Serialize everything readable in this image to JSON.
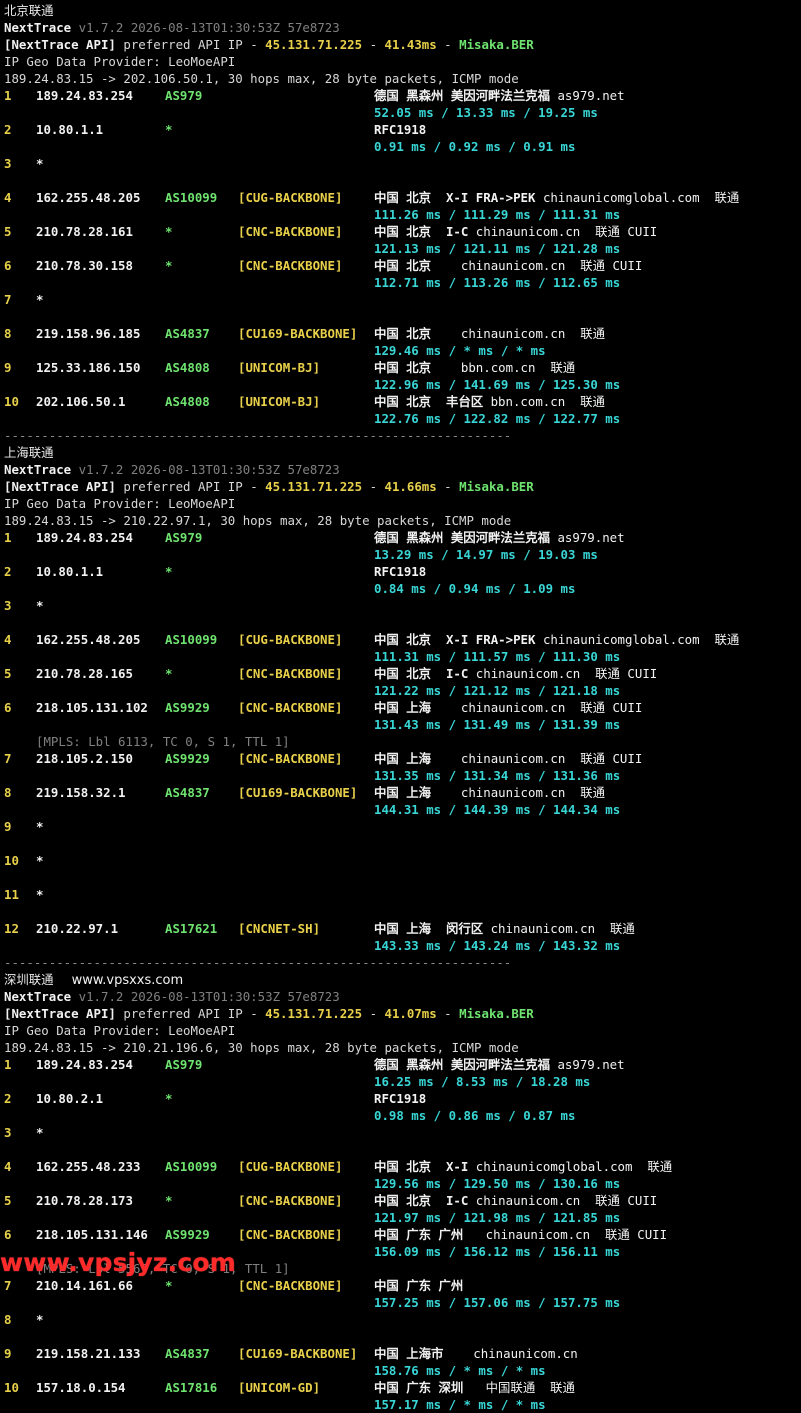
{
  "sections": [
    {
      "title": "北京联通",
      "extra": "",
      "version": "v1.7.2 2026-08-13T01:30:53Z 57e8723",
      "api_prefix": "preferred API IP - ",
      "api_ip": "45.131.71.225",
      "api_ms": "41.43ms",
      "api_node": "Misaka.BER",
      "geo_provider": "IP Geo Data Provider: LeoMoeAPI",
      "route": "189.24.83.15 -> 202.106.50.1, 30 hops max, 28 byte packets, ICMP mode",
      "hops": [
        {
          "n": "1",
          "ip": "189.24.83.254",
          "as": "AS979",
          "tag": "",
          "geo_b": "德国 黑森州 美因河畔法兰克福",
          "geo_n": "as979.net",
          "rtt": "52.05 ms / 13.33 ms / 19.25 ms",
          "mpls": ""
        },
        {
          "n": "2",
          "ip": "10.80.1.1",
          "as": "*",
          "tag": "",
          "geo_b": "RFC1918",
          "geo_n": "",
          "rtt": "0.91 ms / 0.92 ms / 0.91 ms",
          "mpls": ""
        },
        {
          "n": "3",
          "ip": "*",
          "as": "",
          "tag": "",
          "geo_b": "",
          "geo_n": "",
          "rtt": "",
          "mpls": ""
        },
        {
          "n": "4",
          "ip": "162.255.48.205",
          "as": "AS10099",
          "tag": "[CUG-BACKBONE]",
          "geo_b": "中国 北京  X-I FRA->PEK",
          "geo_n": "chinaunicomglobal.com  联通",
          "rtt": "111.26 ms / 111.29 ms / 111.31 ms",
          "mpls": ""
        },
        {
          "n": "5",
          "ip": "210.78.28.161",
          "as": "*",
          "tag": "[CNC-BACKBONE]",
          "geo_b": "中国 北京  I-C",
          "geo_n": "chinaunicom.cn  联通 CUII",
          "rtt": "121.13 ms / 121.11 ms / 121.28 ms",
          "mpls": ""
        },
        {
          "n": "6",
          "ip": "210.78.30.158",
          "as": "*",
          "tag": "[CNC-BACKBONE]",
          "geo_b": "中国 北京",
          "geo_n": "   chinaunicom.cn  联通 CUII",
          "rtt": "112.71 ms / 113.26 ms / 112.65 ms",
          "mpls": ""
        },
        {
          "n": "7",
          "ip": "*",
          "as": "",
          "tag": "",
          "geo_b": "",
          "geo_n": "",
          "rtt": "",
          "mpls": ""
        },
        {
          "n": "8",
          "ip": "219.158.96.185",
          "as": "AS4837",
          "tag": "[CU169-BACKBONE]",
          "geo_b": "中国 北京",
          "geo_n": "   chinaunicom.cn  联通",
          "rtt": "129.46 ms / * ms / * ms",
          "mpls": ""
        },
        {
          "n": "9",
          "ip": "125.33.186.150",
          "as": "AS4808",
          "tag": "[UNICOM-BJ]",
          "geo_b": "中国 北京",
          "geo_n": "   bbn.com.cn  联通",
          "rtt": "122.96 ms / 141.69 ms / 125.30 ms",
          "mpls": ""
        },
        {
          "n": "10",
          "ip": "202.106.50.1",
          "as": "AS4808",
          "tag": "[UNICOM-BJ]",
          "geo_b": "中国 北京  丰台区",
          "geo_n": "bbn.com.cn  联通",
          "rtt": "122.76 ms / 122.82 ms / 122.77 ms",
          "mpls": ""
        }
      ]
    },
    {
      "title": "上海联通",
      "extra": "",
      "version": "v1.7.2 2026-08-13T01:30:53Z 57e8723",
      "api_prefix": "preferred API IP - ",
      "api_ip": "45.131.71.225",
      "api_ms": "41.66ms",
      "api_node": "Misaka.BER",
      "geo_provider": "IP Geo Data Provider: LeoMoeAPI",
      "route": "189.24.83.15 -> 210.22.97.1, 30 hops max, 28 byte packets, ICMP mode",
      "hops": [
        {
          "n": "1",
          "ip": "189.24.83.254",
          "as": "AS979",
          "tag": "",
          "geo_b": "德国 黑森州 美因河畔法兰克福",
          "geo_n": "as979.net",
          "rtt": "13.29 ms / 14.97 ms / 19.03 ms",
          "mpls": ""
        },
        {
          "n": "2",
          "ip": "10.80.1.1",
          "as": "*",
          "tag": "",
          "geo_b": "RFC1918",
          "geo_n": "",
          "rtt": "0.84 ms / 0.94 ms / 1.09 ms",
          "mpls": ""
        },
        {
          "n": "3",
          "ip": "*",
          "as": "",
          "tag": "",
          "geo_b": "",
          "geo_n": "",
          "rtt": "",
          "mpls": ""
        },
        {
          "n": "4",
          "ip": "162.255.48.205",
          "as": "AS10099",
          "tag": "[CUG-BACKBONE]",
          "geo_b": "中国 北京  X-I FRA->PEK",
          "geo_n": "chinaunicomglobal.com  联通",
          "rtt": "111.31 ms / 111.57 ms / 111.30 ms",
          "mpls": ""
        },
        {
          "n": "5",
          "ip": "210.78.28.165",
          "as": "*",
          "tag": "[CNC-BACKBONE]",
          "geo_b": "中国 北京  I-C",
          "geo_n": "chinaunicom.cn  联通 CUII",
          "rtt": "121.22 ms / 121.12 ms / 121.18 ms",
          "mpls": ""
        },
        {
          "n": "6",
          "ip": "218.105.131.102",
          "as": "AS9929",
          "tag": "[CNC-BACKBONE]",
          "geo_b": "中国 上海",
          "geo_n": "   chinaunicom.cn  联通 CUII",
          "rtt": "131.43 ms / 131.49 ms / 131.39 ms",
          "mpls": "[MPLS: Lbl 6113, TC 0, S 1, TTL 1]"
        },
        {
          "n": "7",
          "ip": "218.105.2.150",
          "as": "AS9929",
          "tag": "[CNC-BACKBONE]",
          "geo_b": "中国 上海",
          "geo_n": "   chinaunicom.cn  联通 CUII",
          "rtt": "131.35 ms / 131.34 ms / 131.36 ms",
          "mpls": ""
        },
        {
          "n": "8",
          "ip": "219.158.32.1",
          "as": "AS4837",
          "tag": "[CU169-BACKBONE]",
          "geo_b": "中国 上海",
          "geo_n": "   chinaunicom.cn  联通",
          "rtt": "144.31 ms / 144.39 ms / 144.34 ms",
          "mpls": ""
        },
        {
          "n": "9",
          "ip": "*",
          "as": "",
          "tag": "",
          "geo_b": "",
          "geo_n": "",
          "rtt": "",
          "mpls": ""
        },
        {
          "n": "10",
          "ip": "*",
          "as": "",
          "tag": "",
          "geo_b": "",
          "geo_n": "",
          "rtt": "",
          "mpls": ""
        },
        {
          "n": "11",
          "ip": "*",
          "as": "",
          "tag": "",
          "geo_b": "",
          "geo_n": "",
          "rtt": "",
          "mpls": ""
        },
        {
          "n": "12",
          "ip": "210.22.97.1",
          "as": "AS17621",
          "tag": "[CNCNET-SH]",
          "geo_b": "中国 上海  闵行区",
          "geo_n": "chinaunicom.cn  联通",
          "rtt": "143.33 ms / 143.24 ms / 143.32 ms",
          "mpls": ""
        }
      ]
    },
    {
      "title": "深圳联通",
      "extra": "www.vpsxxs.com",
      "version": "v1.7.2 2026-08-13T01:30:53Z 57e8723",
      "api_prefix": "preferred API IP - ",
      "api_ip": "45.131.71.225",
      "api_ms": "41.07ms",
      "api_node": "Misaka.BER",
      "geo_provider": "IP Geo Data Provider: LeoMoeAPI",
      "route": "189.24.83.15 -> 210.21.196.6, 30 hops max, 28 byte packets, ICMP mode",
      "hops": [
        {
          "n": "1",
          "ip": "189.24.83.254",
          "as": "AS979",
          "tag": "",
          "geo_b": "德国 黑森州 美因河畔法兰克福",
          "geo_n": "as979.net",
          "rtt": "16.25 ms / 8.53 ms / 18.28 ms",
          "mpls": ""
        },
        {
          "n": "2",
          "ip": "10.80.2.1",
          "as": "*",
          "tag": "",
          "geo_b": "RFC1918",
          "geo_n": "",
          "rtt": "0.98 ms / 0.86 ms / 0.87 ms",
          "mpls": ""
        },
        {
          "n": "3",
          "ip": "*",
          "as": "",
          "tag": "",
          "geo_b": "",
          "geo_n": "",
          "rtt": "",
          "mpls": ""
        },
        {
          "n": "4",
          "ip": "162.255.48.233",
          "as": "AS10099",
          "tag": "[CUG-BACKBONE]",
          "geo_b": "中国 北京  X-I",
          "geo_n": "chinaunicomglobal.com  联通",
          "rtt": "129.56 ms / 129.50 ms / 130.16 ms",
          "mpls": ""
        },
        {
          "n": "5",
          "ip": "210.78.28.173",
          "as": "*",
          "tag": "[CNC-BACKBONE]",
          "geo_b": "中国 北京  I-C",
          "geo_n": "chinaunicom.cn  联通 CUII",
          "rtt": "121.97 ms / 121.98 ms / 121.85 ms",
          "mpls": ""
        },
        {
          "n": "6",
          "ip": "218.105.131.146",
          "as": "AS9929",
          "tag": "[CNC-BACKBONE]",
          "geo_b": "中国 广东 广州",
          "geo_n": "  chinaunicom.cn  联通 CUII",
          "rtt": "156.09 ms / 156.12 ms / 156.11 ms",
          "mpls": "[MPLS: Lbl 5567, TC 0, S 1, TTL 1]"
        },
        {
          "n": "7",
          "ip": "210.14.161.66",
          "as": "*",
          "tag": "[CNC-BACKBONE]",
          "geo_b": "中国 广东 广州",
          "geo_n": "",
          "rtt": "157.25 ms / 157.06 ms / 157.75 ms",
          "mpls": ""
        },
        {
          "n": "8",
          "ip": "*",
          "as": "",
          "tag": "",
          "geo_b": "",
          "geo_n": "",
          "rtt": "",
          "mpls": ""
        },
        {
          "n": "9",
          "ip": "219.158.21.133",
          "as": "AS4837",
          "tag": "[CU169-BACKBONE]",
          "geo_b": "中国 上海市",
          "geo_n": "   chinaunicom.cn",
          "rtt": "158.76 ms / * ms / * ms",
          "mpls": ""
        },
        {
          "n": "10",
          "ip": "157.18.0.154",
          "as": "AS17816",
          "tag": "[UNICOM-GD]",
          "geo_b": "中国 广东 深圳",
          "geo_n": "  中国联通  联通",
          "rtt": "157.17 ms / * ms / * ms",
          "mpls": ""
        }
      ]
    }
  ],
  "separator": "--------------------------------------------------------------------",
  "nexttrace_label": "NextTrace",
  "api_label": "[NextTrace API]",
  "watermark": "www.vpsjyz.com"
}
